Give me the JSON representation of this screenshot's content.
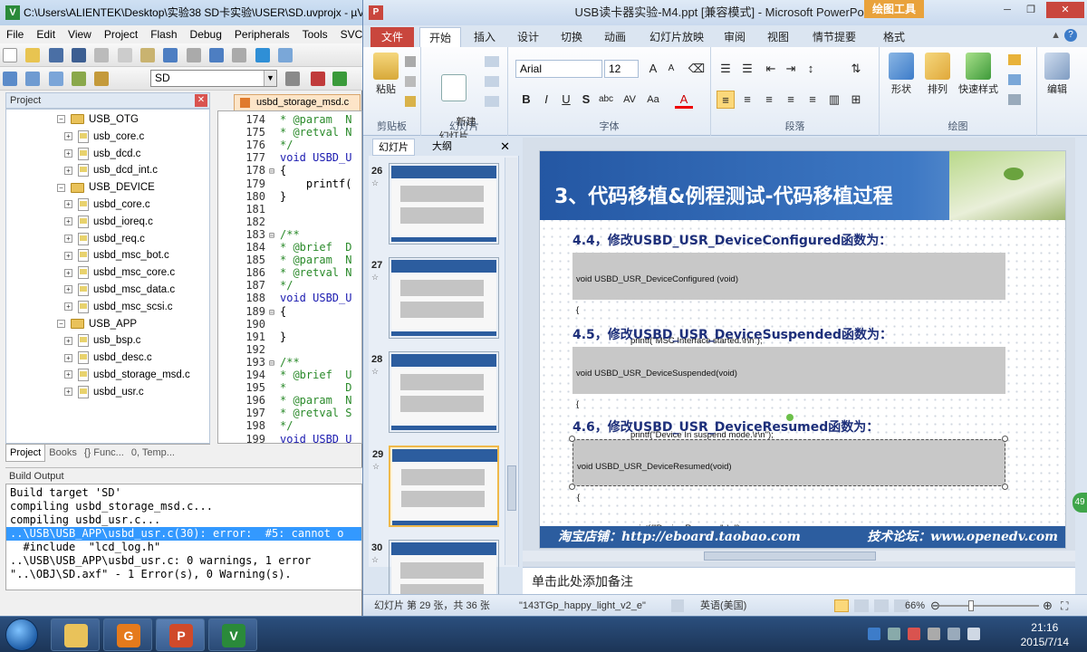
{
  "keil": {
    "title": "C:\\Users\\ALIENTEK\\Desktop\\实验38 SD卡实验\\USER\\SD.uvprojx - µV",
    "menu": [
      "File",
      "Edit",
      "View",
      "Project",
      "Flash",
      "Debug",
      "Peripherals",
      "Tools",
      "SVCS"
    ],
    "target": "SD",
    "project_label": "Project",
    "tree": [
      {
        "type": "folder",
        "label": "USB_OTG",
        "level": 0
      },
      {
        "type": "file",
        "label": "usb_core.c",
        "level": 1
      },
      {
        "type": "file",
        "label": "usb_dcd.c",
        "level": 1
      },
      {
        "type": "file",
        "label": "usb_dcd_int.c",
        "level": 1
      },
      {
        "type": "folder",
        "label": "USB_DEVICE",
        "level": 0
      },
      {
        "type": "file",
        "label": "usbd_core.c",
        "level": 1
      },
      {
        "type": "file",
        "label": "usbd_ioreq.c",
        "level": 1
      },
      {
        "type": "file",
        "label": "usbd_req.c",
        "level": 1
      },
      {
        "type": "file",
        "label": "usbd_msc_bot.c",
        "level": 1
      },
      {
        "type": "file",
        "label": "usbd_msc_core.c",
        "level": 1
      },
      {
        "type": "file",
        "label": "usbd_msc_data.c",
        "level": 1
      },
      {
        "type": "file",
        "label": "usbd_msc_scsi.c",
        "level": 1
      },
      {
        "type": "folder",
        "label": "USB_APP",
        "level": 0
      },
      {
        "type": "file",
        "label": "usb_bsp.c",
        "level": 1
      },
      {
        "type": "file",
        "label": "usbd_desc.c",
        "level": 1
      },
      {
        "type": "file",
        "label": "usbd_storage_msd.c",
        "level": 1
      },
      {
        "type": "file",
        "label": "usbd_usr.c",
        "level": 1
      }
    ],
    "proj_tabs": [
      "Project",
      "Books",
      "{} Func...",
      "0, Temp..."
    ],
    "editor_tab": "usbd_storage_msd.c",
    "code_lines": [
      {
        "n": "174",
        "f": "",
        "t": "* @param  N",
        "c": "cm"
      },
      {
        "n": "175",
        "f": "",
        "t": "* @retval N",
        "c": "cm"
      },
      {
        "n": "176",
        "f": "",
        "t": "*/",
        "c": "cm"
      },
      {
        "n": "177",
        "f": "",
        "t": "void USBD_U",
        "c": "kw"
      },
      {
        "n": "178",
        "f": "⊟",
        "t": "{",
        "c": ""
      },
      {
        "n": "179",
        "f": "",
        "t": "    printf(",
        "c": ""
      },
      {
        "n": "180",
        "f": "",
        "t": "}",
        "c": ""
      },
      {
        "n": "181",
        "f": "",
        "t": "",
        "c": ""
      },
      {
        "n": "182",
        "f": "",
        "t": "",
        "c": ""
      },
      {
        "n": "183",
        "f": "⊟",
        "t": "/**",
        "c": "cm"
      },
      {
        "n": "184",
        "f": "",
        "t": "* @brief  D",
        "c": "cm"
      },
      {
        "n": "185",
        "f": "",
        "t": "* @param  N",
        "c": "cm"
      },
      {
        "n": "186",
        "f": "",
        "t": "* @retval N",
        "c": "cm"
      },
      {
        "n": "187",
        "f": "",
        "t": "*/",
        "c": "cm"
      },
      {
        "n": "188",
        "f": "",
        "t": "void USBD_U",
        "c": "kw"
      },
      {
        "n": "189",
        "f": "⊟",
        "t": "{",
        "c": ""
      },
      {
        "n": "190",
        "f": "",
        "t": "",
        "c": ""
      },
      {
        "n": "191",
        "f": "",
        "t": "}",
        "c": ""
      },
      {
        "n": "192",
        "f": "",
        "t": "",
        "c": ""
      },
      {
        "n": "193",
        "f": "⊟",
        "t": "/**",
        "c": "cm"
      },
      {
        "n": "194",
        "f": "",
        "t": "* @brief  U",
        "c": "cm"
      },
      {
        "n": "195",
        "f": "",
        "t": "*         D",
        "c": "cm"
      },
      {
        "n": "196",
        "f": "",
        "t": "* @param  N",
        "c": "cm"
      },
      {
        "n": "197",
        "f": "",
        "t": "* @retval S",
        "c": "cm"
      },
      {
        "n": "198",
        "f": "",
        "t": "*/",
        "c": "cm"
      },
      {
        "n": "199",
        "f": "",
        "t": "void USBD_U",
        "c": "kw"
      }
    ],
    "build_label": "Build Output",
    "build_lines": [
      "Build target 'SD'",
      "compiling usbd_storage_msd.c...",
      "compiling usbd_usr.c...",
      "..\\USB\\USB_APP\\usbd_usr.c(30): error:  #5: cannot o",
      "  #include  \"lcd_log.h\"",
      "..\\USB\\USB_APP\\usbd_usr.c: 0 warnings, 1 error",
      "\"..\\OBJ\\SD.axf\" - 1 Error(s), 0 Warning(s)."
    ]
  },
  "ppt": {
    "title": "USB读卡器实验-M4.ppt [兼容模式] - Microsoft PowerPoint",
    "draw_tools": "绘图工具",
    "file_tab": "文件",
    "tabs": [
      "开始",
      "插入",
      "设计",
      "切换",
      "动画",
      "幻灯片放映",
      "审阅",
      "视图",
      "情节提要",
      "格式"
    ],
    "groups": {
      "clipboard": "剪贴板",
      "slides": "幻灯片",
      "font": "字体",
      "paragraph": "段落",
      "drawing": "绘图",
      "paste": "粘贴",
      "new_slide": "新建\n幻灯片",
      "shape": "形状",
      "arrange": "排列",
      "quick_style": "快速样式",
      "edit": "编辑"
    },
    "font_name": "Arial",
    "font_size": "12",
    "panel_tabs": [
      "幻灯片",
      "大纲"
    ],
    "thumbs": [
      "26",
      "27",
      "28",
      "29",
      "30"
    ],
    "selected_thumb": "29",
    "slide": {
      "title": "3、代码移植&例程测试-代码移植过程",
      "sections": [
        {
          "heading": "4.4，修改USBD_USR_DeviceConfigured函数为：",
          "code": [
            "void USBD_USR_DeviceConfigured (void)",
            "{",
            "printf(\"MSC Interface started.\\r\\n\");",
            "}"
          ]
        },
        {
          "heading": "4.5，修改USBD_USR_DeviceSuspended函数为：",
          "code": [
            "void USBD_USR_DeviceSuspended(void)",
            "{",
            "printf(\"Device In suspend mode.\\r\\n\");",
            "}"
          ]
        },
        {
          "heading": "4.6，修改USBD_USR_DeviceResumed函数为：",
          "code": [
            "void USBD_USR_DeviceResumed(void)",
            "{",
            "printf(\"Device Resumed\\r\\n\");",
            "}"
          ]
        }
      ],
      "footer_left": "淘宝店铺：http://eboard.taobao.com",
      "footer_right": "技术论坛：www.openedv.com"
    },
    "notes": "单击此处添加备注",
    "status": {
      "slide_info": "幻灯片 第 29 张，共 36 张",
      "theme": "\"143TGp_happy_light_v2_e\"",
      "language": "英语(美国)",
      "zoom": "66%"
    }
  },
  "taskbar": {
    "time": "21:16",
    "date": "2015/7/14",
    "badge": "49"
  },
  "colors": {
    "accent": "#2c5d9f",
    "ppt_file": "#c9463d",
    "selection": "#3399ff"
  }
}
